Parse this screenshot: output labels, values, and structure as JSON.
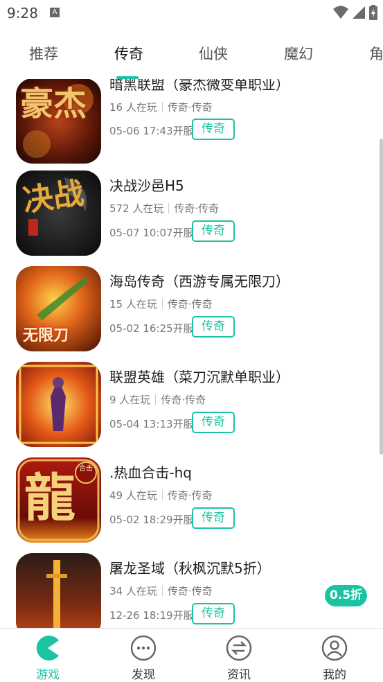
{
  "status_bar": {
    "time": "9:28",
    "notification_letter": "A",
    "icons": [
      "wifi-icon",
      "signal-icon",
      "battery-charging-icon"
    ]
  },
  "tabs": [
    {
      "label": "推荐",
      "active": false
    },
    {
      "label": "传奇",
      "active": true
    },
    {
      "label": "仙侠",
      "active": false
    },
    {
      "label": "魔幻",
      "active": false
    },
    {
      "label": "角",
      "active": false
    }
  ],
  "games": [
    {
      "title": "暗黑联盟（豪杰微变单职业）",
      "players": "16 人在玩",
      "category": "传奇·传奇",
      "open_time": "05-06 17:43开服",
      "tag": "传奇",
      "icon_text": "豪杰",
      "discount": ""
    },
    {
      "title": "决战沙邑H5",
      "players": "572 人在玩",
      "category": "传奇·传奇",
      "open_time": "05-07 10:07开服",
      "tag": "传奇",
      "icon_text": "决战",
      "discount": ""
    },
    {
      "title": "海岛传奇（西游专属无限刀）",
      "players": "15 人在玩",
      "category": "传奇·传奇",
      "open_time": "05-02 16:25开服",
      "tag": "传奇",
      "icon_text": "无限刀",
      "discount": ""
    },
    {
      "title": "联盟英雄（菜刀沉默单职业）",
      "players": "9 人在玩",
      "category": "传奇·传奇",
      "open_time": "05-04 13:13开服",
      "tag": "传奇",
      "icon_text": "",
      "discount": ""
    },
    {
      "title": ".热血合击-hq",
      "players": "49 人在玩",
      "category": "传奇·传奇",
      "open_time": "05-02 18:29开服",
      "tag": "传奇",
      "icon_text": "龍",
      "icon_badge": "合击",
      "discount": ""
    },
    {
      "title": "屠龙圣域（秋枫沉默5折）",
      "players": "34 人在玩",
      "category": "传奇·传奇",
      "open_time": "12-26 18:19开服",
      "tag": "传奇",
      "icon_text": "",
      "discount": "0.5折"
    }
  ],
  "bottom_nav": [
    {
      "label": "游戏",
      "icon": "pacman-icon",
      "active": true
    },
    {
      "label": "发现",
      "icon": "more-dots-icon",
      "active": false
    },
    {
      "label": "资讯",
      "icon": "swap-arrows-icon",
      "active": false
    },
    {
      "label": "我的",
      "icon": "user-icon",
      "active": false
    }
  ],
  "colors": {
    "accent": "#1cc3a2"
  }
}
